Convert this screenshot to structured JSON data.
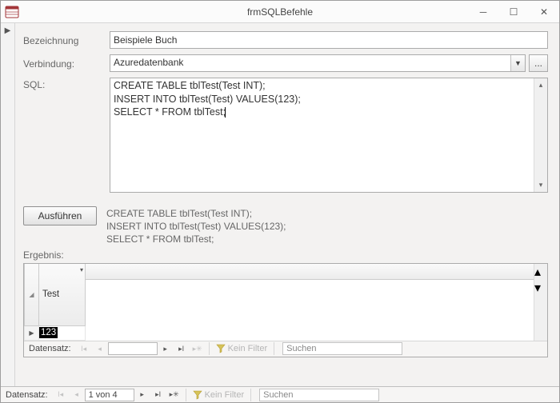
{
  "window": {
    "title": "frmSQLBefehle"
  },
  "labels": {
    "bezeichnung": "Bezeichnung",
    "verbindung": "Verbindung:",
    "sql": "SQL:",
    "ergebnis": "Ergebnis:"
  },
  "fields": {
    "bezeichnung": "Beispiele Buch",
    "verbindung": "Azuredatenbank",
    "sql_line1": "CREATE TABLE tblTest(Test INT);",
    "sql_line2": "INSERT INTO tblTest(Test) VALUES(123);",
    "sql_line3": "SELECT * FROM tblTest;"
  },
  "buttons": {
    "execute": "Ausführen",
    "ellipsis": "..."
  },
  "echo": "CREATE TABLE tblTest(Test INT);\nINSERT INTO tblTest(Test) VALUES(123);\nSELECT * FROM tblTest;",
  "grid": {
    "columns": [
      "Test"
    ],
    "rows": [
      [
        123
      ]
    ]
  },
  "nav": {
    "datensatz": "Datensatz:",
    "inner_pos": "",
    "outer_pos": "1 von 4",
    "kein_filter": "Kein Filter",
    "suchen": "Suchen"
  }
}
